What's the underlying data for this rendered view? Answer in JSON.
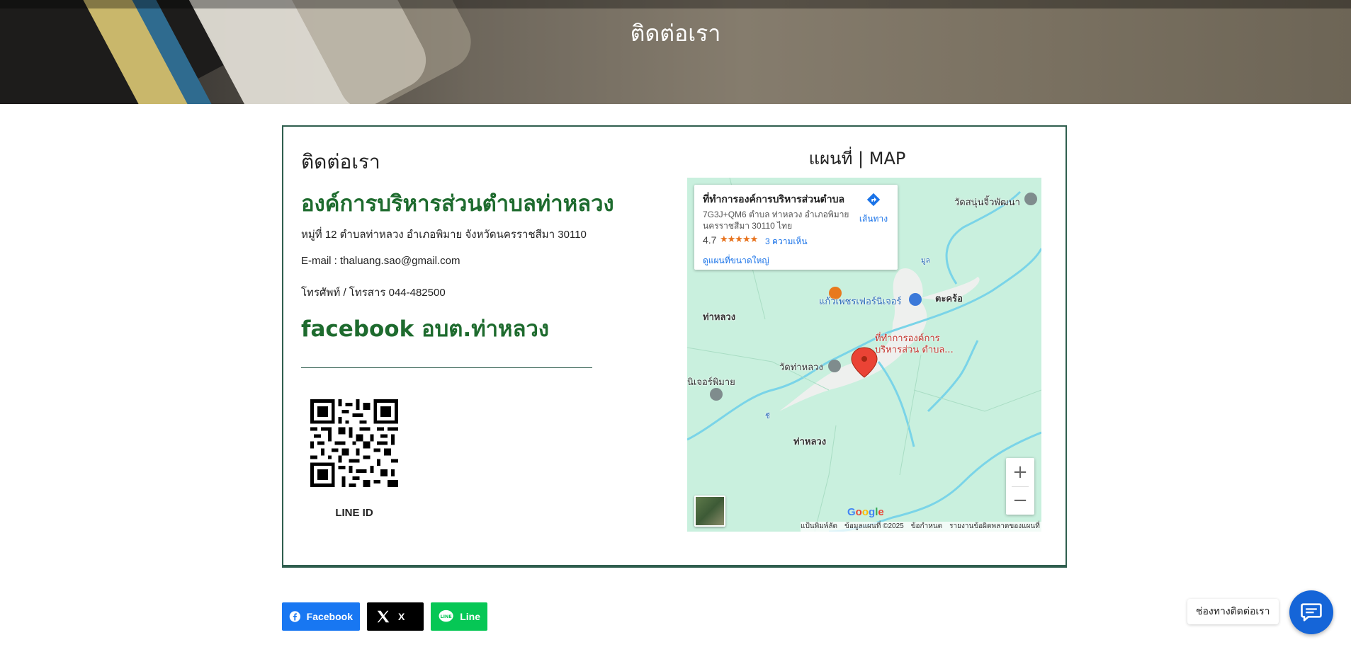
{
  "banner": {
    "title": "ติดต่อเรา"
  },
  "contact": {
    "heading": "ติดต่อเรา",
    "org_name": "องค์การบริหารส่วนตำบลท่าหลวง",
    "address": "หมู่ที่ 12  ตำบลท่าหลวง อำเภอพิมาย  จังหวัดนครราชสีมา  30110",
    "email": "E-mail : thaluang.sao@gmail.com",
    "phone": "โทรศัพท์ / โทรสาร 044-482500",
    "facebook": "facebook อบต.ท่าหลวง",
    "qr_caption": "LINE ID"
  },
  "map": {
    "title": "แผนที่ | MAP",
    "place_card": {
      "name": "ที่ทำการองค์การบริหารส่วนตำบล...",
      "address": "7G3J+QM6 ตำบล ท่าหลวง อำเภอพิมาย นครราชสีมา 30110 ไทย",
      "rating": "4.7",
      "stars": "★★★★★",
      "reviews": "3 ความเห็น",
      "larger_map": "ดูแผนที่ขนาดใหญ่",
      "directions": "เส้นทาง"
    },
    "labels": {
      "temple_ne": "วัดสนุ่นจิ้วพัฒนา",
      "tha_luang_w": "ท่าหลวง",
      "furniture": "แก้วเพชรเฟอร์นิเจอร์",
      "takhro": "ตะคร้อ",
      "marker_line1": "ที่ทำการองค์การ",
      "marker_line2": "บริหารส่วน ตำบล...",
      "wat_tha_luang": "วัดท่าหลวง",
      "furniture_w": "นิเจอร์พิมาย",
      "tha_luang_s": "ท่าหลวง",
      "river1": "มูล",
      "river2": "ชี"
    },
    "zoom_in": "+",
    "zoom_out": "−",
    "google": "Google",
    "attribution": {
      "shortcuts": "แป้นพิมพ์ลัด",
      "map_data": "ข้อมูลแผนที่ ©2025",
      "terms": "ข้อกำหนด",
      "report": "รายงานข้อผิดพลาดของแผนที่"
    }
  },
  "share": {
    "facebook": "Facebook",
    "x": "X",
    "line": "Line"
  },
  "chat": {
    "label": "ช่องทางติดต่อเรา"
  },
  "colors": {
    "green": "#1e6b2e",
    "border": "#2f5e4e",
    "fb": "#1877f2",
    "line": "#06c755",
    "chat": "#1565d8"
  }
}
